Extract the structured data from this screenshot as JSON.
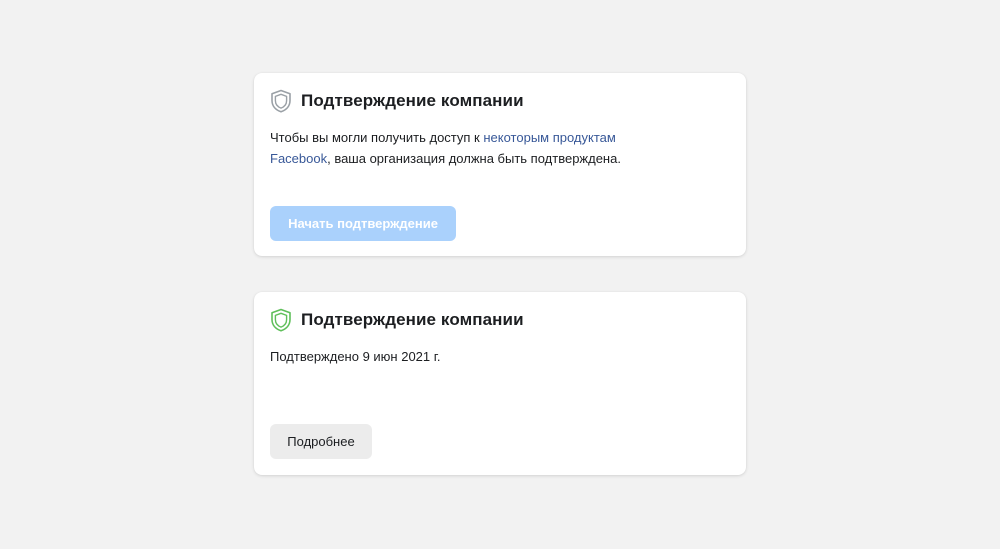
{
  "cards": [
    {
      "title": "Подтверждение компании",
      "shield_icon": "shield-outline-gray-icon",
      "shield_color": "#9aa0a6",
      "body_prefix": "Чтобы вы могли получить доступ к ",
      "body_link": "некоторым продуктам Facebook",
      "body_suffix": ", ваша организация должна быть подтверждена.",
      "button_label": "Начать подтверждение",
      "button_color": "#aad1fc"
    },
    {
      "title": "Подтверждение компании",
      "shield_icon": "shield-outline-green-icon",
      "shield_color": "#5fbf5a",
      "body_text": "Подтверждено 9 июн 2021 г.",
      "button_label": "Подробнее",
      "button_color": "#ececec"
    }
  ],
  "colors": {
    "page_background": "#f2f2f2",
    "link": "#385898",
    "text": "#1c1e21"
  }
}
